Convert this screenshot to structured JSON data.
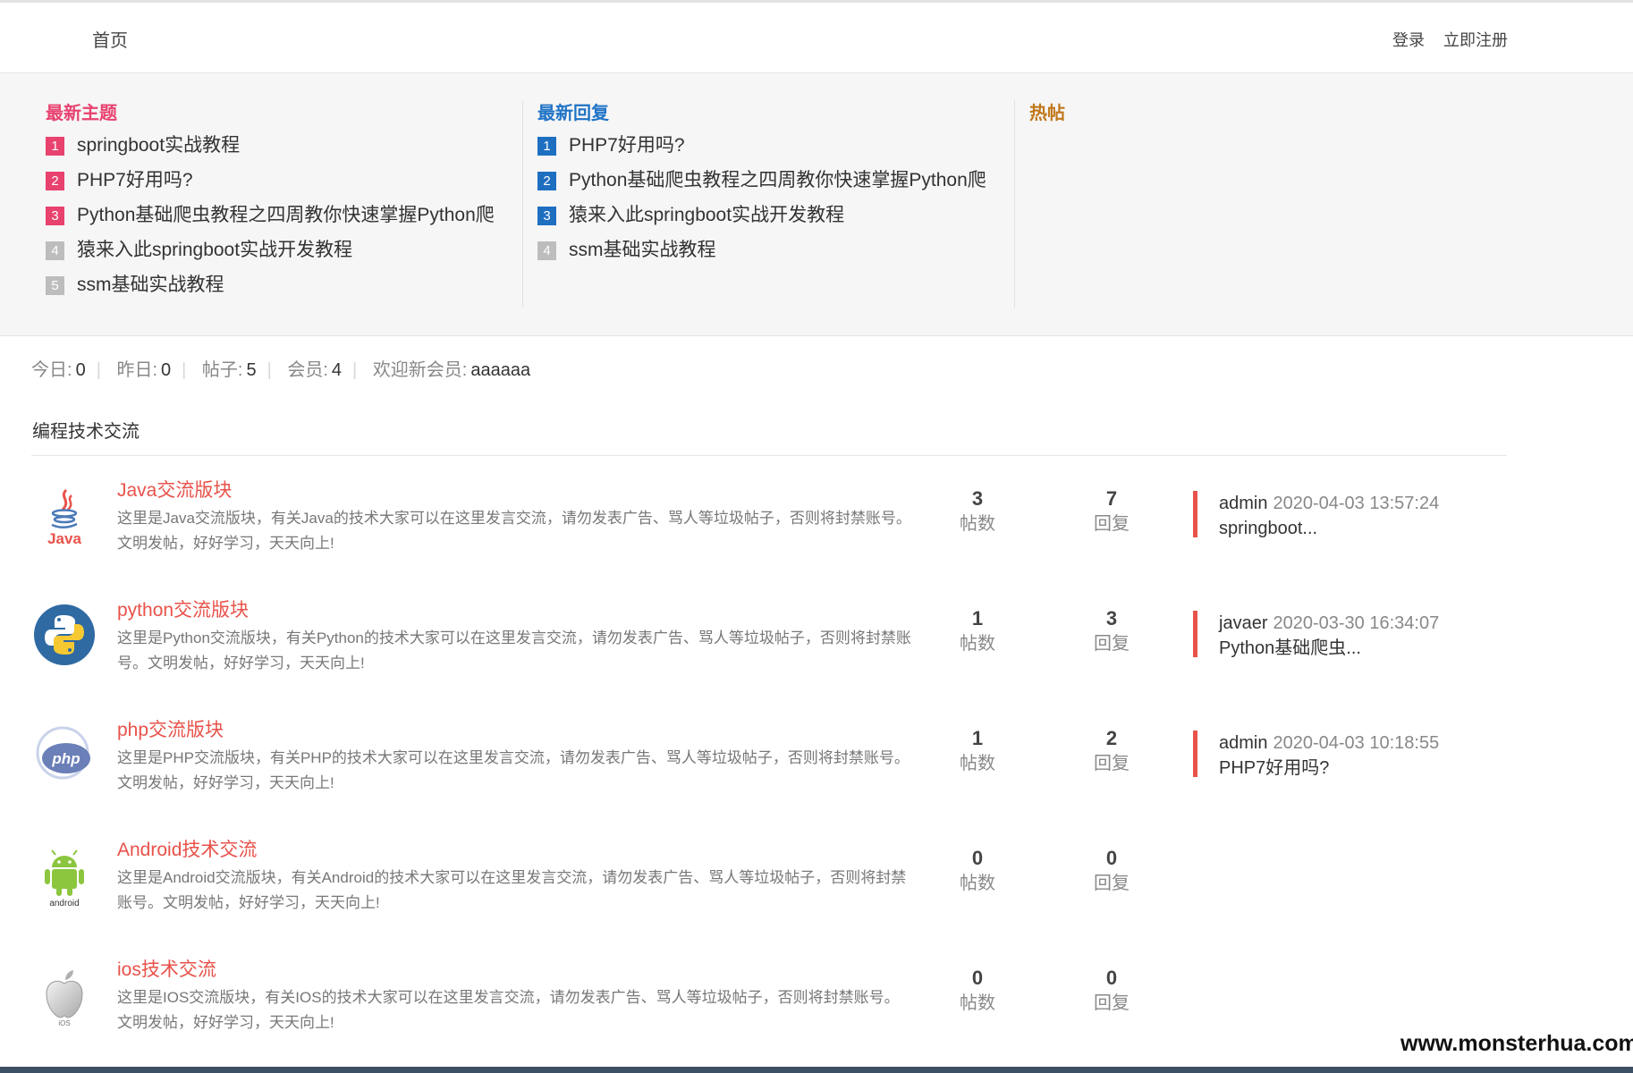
{
  "nav": {
    "home": "首页",
    "login": "登录",
    "register": "立即注册"
  },
  "hot": {
    "latest_topics": {
      "title": "最新主题",
      "items": [
        {
          "rank": "1",
          "title": "springboot实战教程"
        },
        {
          "rank": "2",
          "title": "PHP7好用吗?"
        },
        {
          "rank": "3",
          "title": "Python基础爬虫教程之四周教你快速掌握Python爬"
        },
        {
          "rank": "4",
          "title": "猿来入此springboot实战开发教程"
        },
        {
          "rank": "5",
          "title": "ssm基础实战教程"
        }
      ]
    },
    "latest_replies": {
      "title": "最新回复",
      "items": [
        {
          "rank": "1",
          "title": "PHP7好用吗?"
        },
        {
          "rank": "2",
          "title": "Python基础爬虫教程之四周教你快速掌握Python爬"
        },
        {
          "rank": "3",
          "title": "猿来入此springboot实战开发教程"
        },
        {
          "rank": "4",
          "title": "ssm基础实战教程"
        }
      ]
    },
    "hot_posts": {
      "title": "热帖"
    }
  },
  "stats": {
    "today_label": "今日:",
    "today": "0",
    "yesterday_label": "昨日:",
    "yesterday": "0",
    "posts_label": "帖子:",
    "posts": "5",
    "members_label": "会员:",
    "members": "4",
    "welcome_label": "欢迎新会员:",
    "newest_member": "aaaaaa"
  },
  "section": {
    "title": "编程技术交流"
  },
  "forums": [
    {
      "icon": "java-logo-icon",
      "title": "Java交流版块",
      "desc": "这里是Java交流版块，有关Java的技术大家可以在这里发言交流，请勿发表广告、骂人等垃圾帖子，否则将封禁账号。文明发帖，好好学习，天天向上!",
      "posts": "3",
      "posts_label": "帖数",
      "replies": "7",
      "replies_label": "回复",
      "last_user": "admin",
      "last_time": "2020-04-03 13:57:24",
      "last_title": "springboot..."
    },
    {
      "icon": "python-logo-icon",
      "title": "python交流版块",
      "desc": "这里是Python交流版块，有关Python的技术大家可以在这里发言交流，请勿发表广告、骂人等垃圾帖子，否则将封禁账号。文明发帖，好好学习，天天向上!",
      "posts": "1",
      "posts_label": "帖数",
      "replies": "3",
      "replies_label": "回复",
      "last_user": "javaer",
      "last_time": "2020-03-30 16:34:07",
      "last_title": "Python基础爬虫..."
    },
    {
      "icon": "php-logo-icon",
      "title": "php交流版块",
      "desc": "这里是PHP交流版块，有关PHP的技术大家可以在这里发言交流，请勿发表广告、骂人等垃圾帖子，否则将封禁账号。文明发帖，好好学习，天天向上!",
      "posts": "1",
      "posts_label": "帖数",
      "replies": "2",
      "replies_label": "回复",
      "last_user": "admin",
      "last_time": "2020-04-03 10:18:55",
      "last_title": "PHP7好用吗?"
    },
    {
      "icon": "android-logo-icon",
      "title": "Android技术交流",
      "desc": "这里是Android交流版块，有关Android的技术大家可以在这里发言交流，请勿发表广告、骂人等垃圾帖子，否则将封禁账号。文明发帖，好好学习，天天向上!",
      "posts": "0",
      "posts_label": "帖数",
      "replies": "0",
      "replies_label": "回复"
    },
    {
      "icon": "apple-logo-icon",
      "title": "ios技术交流",
      "desc": "这里是IOS交流版块，有关IOS的技术大家可以在这里发言交流，请勿发表广告、骂人等垃圾帖子，否则将封禁账号。文明发帖，好好学习，天天向上!",
      "posts": "0",
      "posts_label": "帖数",
      "replies": "0",
      "replies_label": "回复"
    }
  ],
  "watermark": "www.monsterhua.com",
  "colors": {
    "accent_red": "#e8524a",
    "rank_pink": "#e8426f",
    "rank_blue": "#1f6fc1",
    "hot_orange": "#c0771a"
  }
}
